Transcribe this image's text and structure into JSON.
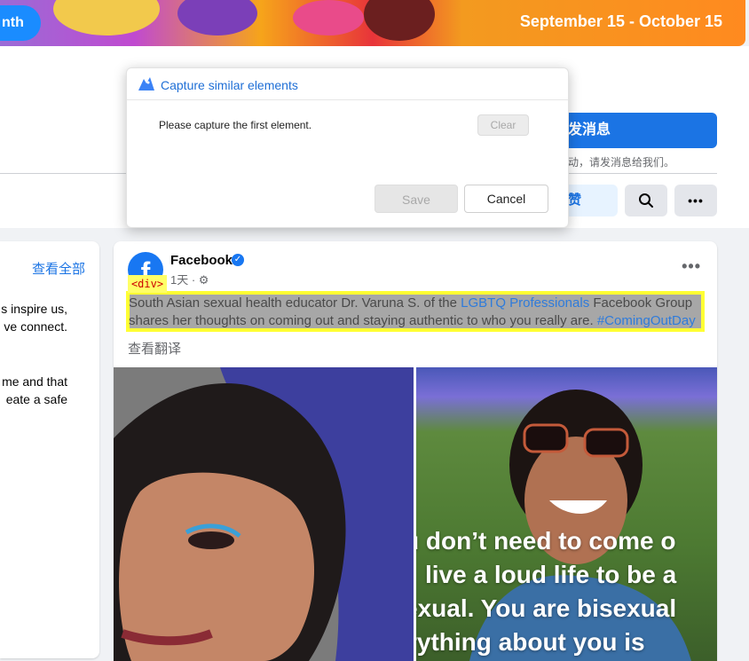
{
  "banner": {
    "month_label": "nth",
    "dates": "September 15 - October 15"
  },
  "header": {
    "message_button": "发消息",
    "message_hint": "动，请发消息给我们。",
    "like_button": "赞",
    "icons": [
      "search-icon",
      "more-icon"
    ]
  },
  "left_card": {
    "see_all": "查看全部",
    "lines": [
      "s inspire us,",
      "ve connect.",
      "me and that",
      "eate a safe"
    ]
  },
  "post": {
    "page_name": "Facebook",
    "meta": "1天 ·",
    "more": "•••",
    "text_before": "South Asian sexual health educator Dr. Varuna S. of the ",
    "link1": "LGBTQ Professionals",
    "text_mid": " Facebook Group shares her thoughts on coming out and staying authentic to who you really are. ",
    "hashtag": "#ComingOutDay",
    "translate": "查看翻译",
    "overlay_lines": [
      "u don’t need to come o",
      "live a loud life to be a",
      "exual. You are bisexual",
      "rything about you is"
    ]
  },
  "inspector": {
    "tag": "<div>"
  },
  "dialog": {
    "title": "Capture similar elements",
    "message": "Please capture the first element.",
    "clear": "Clear",
    "save": "Save",
    "cancel": "Cancel"
  },
  "colors": {
    "accent": "#1b74e4",
    "highlight": "#ffff33",
    "dialog_title": "#1f6fd6"
  }
}
